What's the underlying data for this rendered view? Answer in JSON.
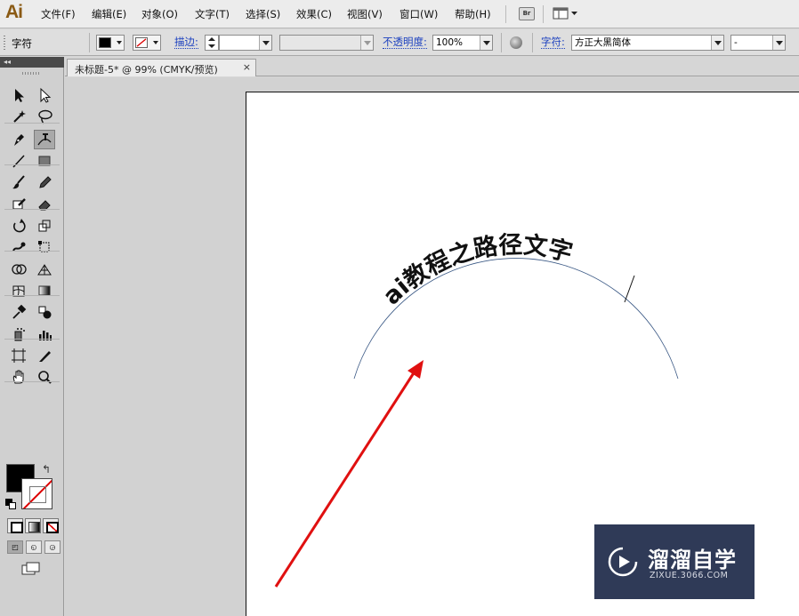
{
  "app": {
    "logo": "Ai",
    "menu": [
      "文件(F)",
      "编辑(E)",
      "对象(O)",
      "文字(T)",
      "选择(S)",
      "效果(C)",
      "视图(V)",
      "窗口(W)",
      "帮助(H)"
    ],
    "bridge_label": "Br"
  },
  "control_bar": {
    "selection_label": "字符",
    "stroke_label": "描边:",
    "stroke_weight": "",
    "brush_definition": "",
    "opacity_label": "不透明度:",
    "opacity_value": "100%",
    "char_label": "字符:",
    "font_family": "方正大黑简体",
    "font_style": "-"
  },
  "document": {
    "tab_title": "未标题-5* @ 99% (CMYK/预览)",
    "close_glyph": "×"
  },
  "artwork": {
    "path_text": "ai教程之路径文字"
  },
  "colors": {
    "fill": "#000000",
    "stroke": "none",
    "arrow": "#e01010",
    "path": "#3c5a86"
  },
  "icons": {
    "tools": [
      "selection-icon",
      "direct-selection-icon",
      "magic-wand-icon",
      "lasso-icon",
      "pen-icon",
      "type-on-path-icon",
      "line-segment-icon",
      "rectangle-icon",
      "paintbrush-icon",
      "pencil-icon",
      "blob-brush-icon",
      "eraser-icon",
      "rotate-icon",
      "scale-icon",
      "warp-icon",
      "free-transform-icon",
      "shape-builder-icon",
      "perspective-grid-icon",
      "mesh-icon",
      "gradient-icon",
      "eyedropper-icon",
      "blend-icon",
      "symbol-sprayer-icon",
      "column-graph-icon",
      "artboard-icon",
      "slice-icon",
      "hand-icon",
      "zoom-icon"
    ]
  },
  "watermark": {
    "title": "溜溜自学",
    "url": "ZIXUE.3066.COM"
  }
}
